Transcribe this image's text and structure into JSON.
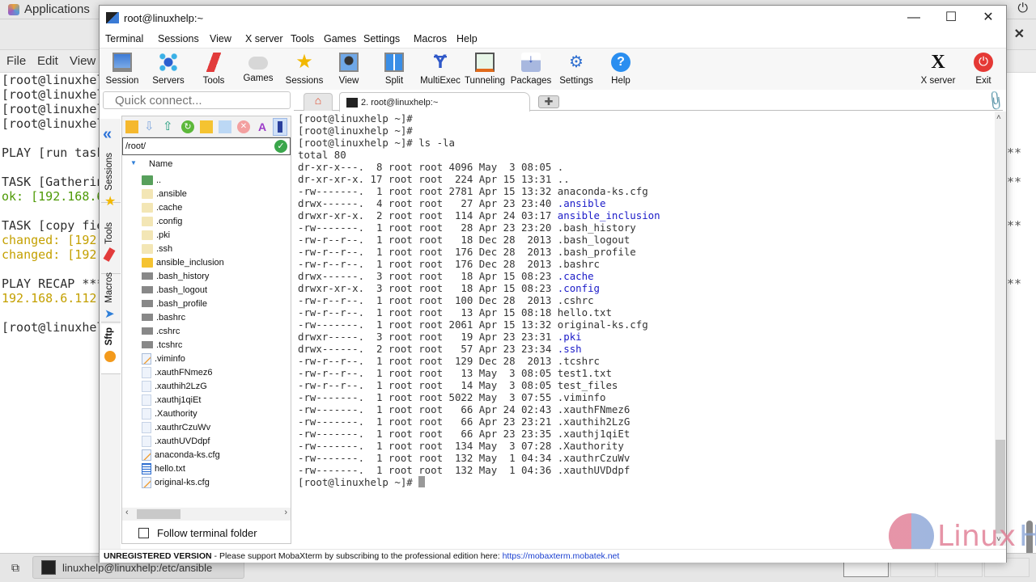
{
  "desktop": {
    "apps_label": "Applications",
    "power_icon": "power-icon"
  },
  "bg_terminal": {
    "menu": [
      "File",
      "Edit",
      "View"
    ],
    "lines": [
      {
        "text": "[root@linuxhel",
        "color": ""
      },
      {
        "text": "[root@linuxhel",
        "color": ""
      },
      {
        "text": "[root@linuxhel",
        "color": ""
      },
      {
        "text": "[root@linuxhel",
        "color": ""
      },
      {
        "text": "",
        "color": ""
      },
      {
        "text": "PLAY [run task",
        "color": ""
      },
      {
        "text": "",
        "color": ""
      },
      {
        "text": "TASK [Gatherin",
        "color": ""
      },
      {
        "text": "ok: [192.168.6",
        "color": "green"
      },
      {
        "text": "",
        "color": ""
      },
      {
        "text": "TASK [copy fie",
        "color": ""
      },
      {
        "text": "changed: [192",
        "color": "yellow"
      },
      {
        "text": "changed: [192",
        "color": "yellow"
      },
      {
        "text": "",
        "color": ""
      },
      {
        "text": "PLAY RECAP ***",
        "color": ""
      },
      {
        "text": "192.168.6.112",
        "color": "yellow"
      },
      {
        "text": "",
        "color": ""
      },
      {
        "text": "[root@linuxhel",
        "color": ""
      }
    ],
    "right_stars": "**"
  },
  "taskbar": {
    "item_label": "linuxhelp@linuxhelp:/etc/ansible"
  },
  "window": {
    "title": "root@linuxhelp:~",
    "menu": [
      "Terminal",
      "Sessions",
      "View",
      "X server",
      "Tools",
      "Games",
      "Settings",
      "Macros",
      "Help"
    ],
    "toolbar": [
      {
        "label": "Session",
        "icon": "session-icon"
      },
      {
        "label": "Servers",
        "icon": "servers-icon"
      },
      {
        "label": "Tools",
        "icon": "tools-icon"
      },
      {
        "label": "Games",
        "icon": "games-icon"
      },
      {
        "label": "Sessions",
        "icon": "star-icon"
      },
      {
        "label": "View",
        "icon": "view-icon"
      },
      {
        "label": "Split",
        "icon": "split-icon"
      },
      {
        "label": "MultiExec",
        "icon": "multiexec-icon"
      },
      {
        "label": "Tunneling",
        "icon": "tunneling-icon"
      },
      {
        "label": "Packages",
        "icon": "packages-icon"
      },
      {
        "label": "Settings",
        "icon": "gear-icon"
      },
      {
        "label": "Help",
        "icon": "help-icon"
      }
    ],
    "toolbar_right": [
      {
        "label": "X server",
        "icon": "x-server-icon"
      },
      {
        "label": "Exit",
        "icon": "exit-icon"
      }
    ],
    "quick_connect_placeholder": "Quick connect...",
    "tabs": {
      "active_label": "2. root@linuxhelp:~"
    },
    "rail_tabs": [
      "Sessions",
      "Tools",
      "Macros",
      "Sftp"
    ]
  },
  "sftp": {
    "path": "/root/",
    "column_name": "Name",
    "files": [
      {
        "name": "..",
        "type": "up"
      },
      {
        "name": ".ansible",
        "type": "folder"
      },
      {
        "name": ".cache",
        "type": "folder"
      },
      {
        "name": ".config",
        "type": "folder"
      },
      {
        "name": ".pki",
        "type": "folder"
      },
      {
        "name": ".ssh",
        "type": "folder"
      },
      {
        "name": "ansible_inclusion",
        "type": "folderd"
      },
      {
        "name": ".bash_history",
        "type": "term"
      },
      {
        "name": ".bash_logout",
        "type": "term"
      },
      {
        "name": ".bash_profile",
        "type": "term"
      },
      {
        "name": ".bashrc",
        "type": "term"
      },
      {
        "name": ".cshrc",
        "type": "term"
      },
      {
        "name": ".tcshrc",
        "type": "term"
      },
      {
        "name": ".viminfo",
        "type": "edit"
      },
      {
        "name": ".xauthFNmez6",
        "type": "doc"
      },
      {
        "name": ".xauthih2LzG",
        "type": "doc"
      },
      {
        "name": ".xauthj1qiEt",
        "type": "doc"
      },
      {
        "name": ".Xauthority",
        "type": "doc"
      },
      {
        "name": ".xauthrCzuWv",
        "type": "doc"
      },
      {
        "name": ".xauthUVDdpf",
        "type": "doc"
      },
      {
        "name": "anaconda-ks.cfg",
        "type": "edit"
      },
      {
        "name": "hello.txt",
        "type": "txt"
      },
      {
        "name": "original-ks.cfg",
        "type": "edit"
      }
    ],
    "follow_label": "Follow terminal folder",
    "follow_checked": false
  },
  "terminal": {
    "prompt_lines": [
      "[root@linuxhelp ~]#",
      "[root@linuxhelp ~]#",
      "[root@linuxhelp ~]# ls -la"
    ],
    "total": "total 80",
    "listing": [
      {
        "meta": "dr-xr-x---.  8 root root 4096 May  3 08:05 ",
        "name": ".",
        "dir": false
      },
      {
        "meta": "dr-xr-xr-x. 17 root root  224 Apr 15 13:31 ",
        "name": "..",
        "dir": false
      },
      {
        "meta": "-rw-------.  1 root root 2781 Apr 15 13:32 ",
        "name": "anaconda-ks.cfg",
        "dir": false
      },
      {
        "meta": "drwx------.  4 root root   27 Apr 23 23:40 ",
        "name": ".ansible",
        "dir": true
      },
      {
        "meta": "drwxr-xr-x.  2 root root  114 Apr 24 03:17 ",
        "name": "ansible_inclusion",
        "dir": true
      },
      {
        "meta": "-rw-------.  1 root root   28 Apr 23 23:20 ",
        "name": ".bash_history",
        "dir": false
      },
      {
        "meta": "-rw-r--r--.  1 root root   18 Dec 28  2013 ",
        "name": ".bash_logout",
        "dir": false
      },
      {
        "meta": "-rw-r--r--.  1 root root  176 Dec 28  2013 ",
        "name": ".bash_profile",
        "dir": false
      },
      {
        "meta": "-rw-r--r--.  1 root root  176 Dec 28  2013 ",
        "name": ".bashrc",
        "dir": false
      },
      {
        "meta": "drwx------.  3 root root   18 Apr 15 08:23 ",
        "name": ".cache",
        "dir": true
      },
      {
        "meta": "drwxr-xr-x.  3 root root   18 Apr 15 08:23 ",
        "name": ".config",
        "dir": true
      },
      {
        "meta": "-rw-r--r--.  1 root root  100 Dec 28  2013 ",
        "name": ".cshrc",
        "dir": false
      },
      {
        "meta": "-rw-r--r--.  1 root root   13 Apr 15 08:18 ",
        "name": "hello.txt",
        "dir": false
      },
      {
        "meta": "-rw-------.  1 root root 2061 Apr 15 13:32 ",
        "name": "original-ks.cfg",
        "dir": false
      },
      {
        "meta": "drwxr-----.  3 root root   19 Apr 23 23:31 ",
        "name": ".pki",
        "dir": true
      },
      {
        "meta": "drwx------.  2 root root   57 Apr 23 23:34 ",
        "name": ".ssh",
        "dir": true
      },
      {
        "meta": "-rw-r--r--.  1 root root  129 Dec 28  2013 ",
        "name": ".tcshrc",
        "dir": false
      },
      {
        "meta": "-rw-r--r--.  1 root root   13 May  3 08:05 ",
        "name": "test1.txt",
        "dir": false
      },
      {
        "meta": "-rw-r--r--.  1 root root   14 May  3 08:05 ",
        "name": "test_files",
        "dir": false
      },
      {
        "meta": "-rw-------.  1 root root 5022 May  3 07:55 ",
        "name": ".viminfo",
        "dir": false
      },
      {
        "meta": "-rw-------.  1 root root   66 Apr 24 02:43 ",
        "name": ".xauthFNmez6",
        "dir": false
      },
      {
        "meta": "-rw-------.  1 root root   66 Apr 23 23:21 ",
        "name": ".xauthih2LzG",
        "dir": false
      },
      {
        "meta": "-rw-------.  1 root root   66 Apr 23 23:35 ",
        "name": ".xauthj1qiEt",
        "dir": false
      },
      {
        "meta": "-rw-------.  1 root root  134 May  3 07:28 ",
        "name": ".Xauthority",
        "dir": false
      },
      {
        "meta": "-rw-------.  1 root root  132 May  1 04:34 ",
        "name": ".xauthrCzuWv",
        "dir": false
      },
      {
        "meta": "-rw-------.  1 root root  132 May  1 04:36 ",
        "name": ".xauthUVDdpf",
        "dir": false
      }
    ],
    "final_prompt": "[root@linuxhelp ~]# "
  },
  "statusbar": {
    "unregistered": "UNREGISTERED VERSION",
    "message": " -  Please support MobaXterm by subscribing to the professional edition here:  ",
    "link": "https://mobaxterm.mobatek.net"
  },
  "watermark": {
    "part1": "Linux",
    "part2": "Help"
  },
  "colors": {
    "directory": "#1a1ac8",
    "ok_green": "#4e9a06",
    "changed_yellow": "#c4a000",
    "accent_blue": "#2d73d8"
  }
}
